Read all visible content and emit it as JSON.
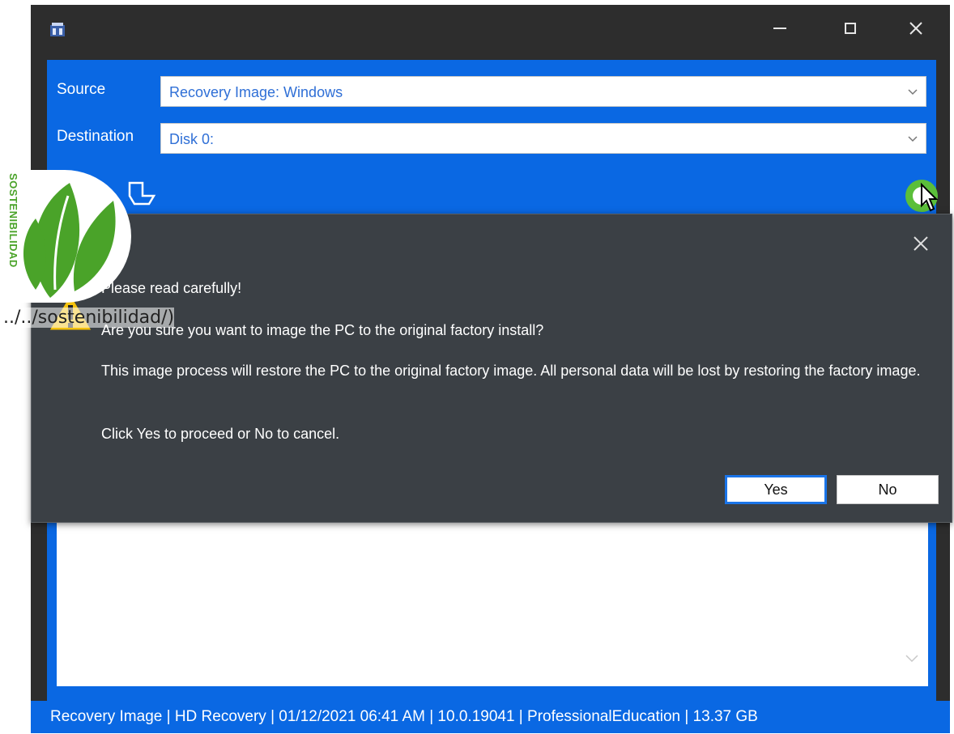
{
  "window": {
    "icon": "app-icon",
    "controls": [
      "minimize-icon",
      "maximize-icon",
      "close-icon"
    ]
  },
  "form": {
    "source_label": "Source",
    "source_value": "Recovery Image: Windows",
    "destination_label": "Destination",
    "destination_value": "Disk 0:"
  },
  "dialog": {
    "heading": "Please read carefully!",
    "question": "Are you sure you want to image the PC to the original factory install?",
    "body": "This image process will restore the PC to the original factory image. All personal data will be lost by restoring the factory image.",
    "instruction": "Click Yes to proceed or No to cancel.",
    "yes_label": "Yes",
    "no_label": "No"
  },
  "status_bar": {
    "text": "Recovery Image | HD Recovery | 01/12/2021 06:41 AM | 10.0.19041 | ProfessionalEducation | 13.37 GB"
  },
  "overlay": {
    "vertical_text": "SOSTENIBILIDAD",
    "link_text": "../../sostenibilidad/)"
  },
  "colors": {
    "accent_blue": "#0a68e3",
    "dialog_bg": "#3b4045",
    "go_green": "#5bbf3a",
    "leaf_green": "#4aa329"
  }
}
